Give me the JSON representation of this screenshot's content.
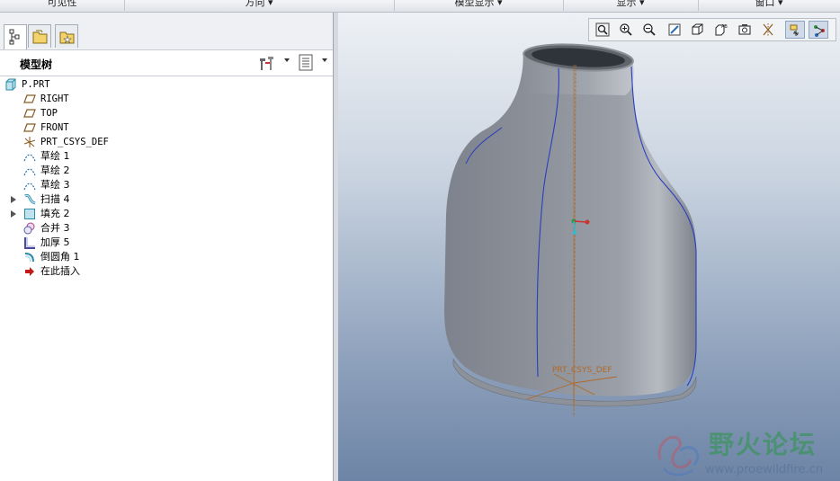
{
  "menubar": {
    "items": [
      "可见性",
      "方向 ▾",
      "模型显示 ▾",
      "显示 ▾",
      "窗口 ▾"
    ]
  },
  "left_panel": {
    "tabs": [
      {
        "icon": "model-tree-tab-icon",
        "active": true
      },
      {
        "icon": "folder-browser-tab-icon",
        "active": false
      },
      {
        "icon": "favorites-tab-icon",
        "active": false
      }
    ],
    "tree_title": "模型树",
    "tree": [
      {
        "label": "P.PRT",
        "icon": "part-icon",
        "expandable": false
      },
      {
        "label": "RIGHT",
        "icon": "datum-plane-icon",
        "expandable": false
      },
      {
        "label": "TOP",
        "icon": "datum-plane-icon",
        "expandable": false
      },
      {
        "label": "FRONT",
        "icon": "datum-plane-icon",
        "expandable": false
      },
      {
        "label": "PRT_CSYS_DEF",
        "icon": "csys-icon",
        "expandable": false
      },
      {
        "label": "草绘 1",
        "icon": "sketch-icon",
        "expandable": false
      },
      {
        "label": "草绘 2",
        "icon": "sketch-icon",
        "expandable": false
      },
      {
        "label": "草绘 3",
        "icon": "sketch-icon",
        "expandable": false
      },
      {
        "label": "扫描 4",
        "icon": "sweep-icon",
        "expandable": true
      },
      {
        "label": "填充 2",
        "icon": "fill-icon",
        "expandable": true
      },
      {
        "label": "合并 3",
        "icon": "merge-icon",
        "expandable": false
      },
      {
        "label": "加厚 5",
        "icon": "thicken-icon",
        "expandable": false
      },
      {
        "label": "倒圆角 1",
        "icon": "round-icon",
        "expandable": false
      },
      {
        "label": "在此插入",
        "icon": "insert-here-arrow-icon",
        "expandable": false
      }
    ]
  },
  "viewport": {
    "csys_label": "PRT_CSYS_DEF",
    "toolbar_icons": [
      "refit-icon",
      "zoom-in-icon",
      "zoom-out-icon",
      "repaint-icon",
      "display-style-icon",
      "saved-views-icon",
      "view-manager-icon",
      "datum-display-icon",
      "spin-center-icon",
      "annotation-display-icon"
    ],
    "watermark_title": "野火论坛",
    "watermark_url": "www.proewildfire.cn"
  },
  "colors": {
    "viewport_top": "#eef1f5",
    "viewport_bottom": "#6d84a6",
    "model_gray": "#7f8490",
    "edge_blue": "#2a3fbf",
    "datum_orange": "#b06a2a"
  }
}
